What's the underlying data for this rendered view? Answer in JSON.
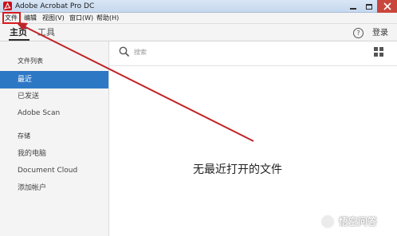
{
  "window": {
    "title": "Adobe Acrobat Pro DC",
    "close_color": "#c9463d"
  },
  "menubar": {
    "items": [
      "文件",
      "编辑",
      "视图(V)",
      "窗口(W)",
      "帮助(H)"
    ],
    "highlighted_item": "文件",
    "highlight_color": "#d8191c"
  },
  "tabs": {
    "home": "主页",
    "tools": "工具",
    "active": "主页"
  },
  "header": {
    "help_icon": "?",
    "login_label": "登录"
  },
  "sidebar": {
    "file_list_heading": "文件列表",
    "file_list_items": [
      {
        "label": "最近",
        "active": true
      },
      {
        "label": "已发送",
        "active": false
      },
      {
        "label": "Adobe Scan",
        "active": false
      }
    ],
    "storage_heading": "存储",
    "storage_items": [
      {
        "label": "我的电脑"
      },
      {
        "label": "Document Cloud"
      },
      {
        "label": "添加帐户"
      }
    ],
    "active_color": "#2d78c5"
  },
  "main": {
    "search_placeholder": "搜索",
    "empty_message": "无最近打开的文件",
    "view_icon": "grid-view-icon"
  },
  "annotation": {
    "arrow_color": "#c0242a",
    "points_to": "文件"
  },
  "watermark": {
    "text": "悟空问答"
  }
}
